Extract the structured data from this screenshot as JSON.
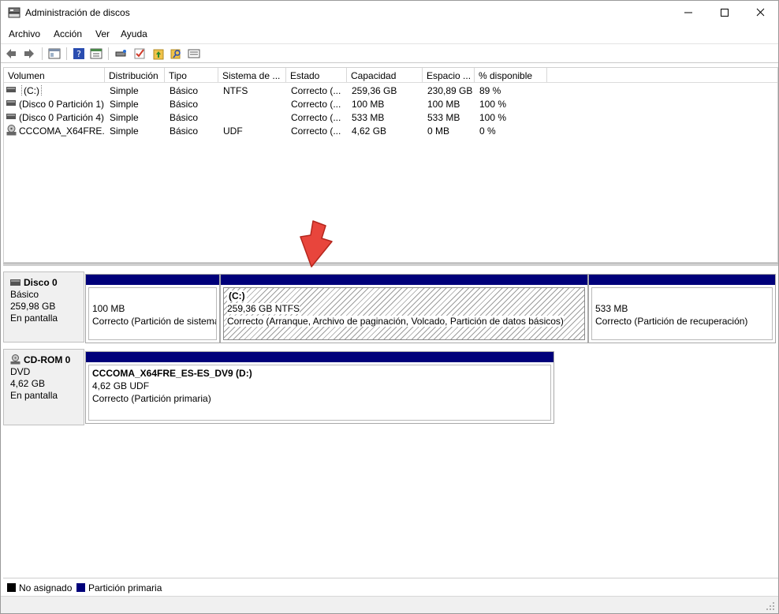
{
  "window": {
    "title": "Administración de discos",
    "controls": {
      "minimize": "—",
      "maximize": "☐",
      "close": "✕"
    }
  },
  "menu": [
    "Archivo",
    "Acción",
    "Ver",
    "Ayuda"
  ],
  "toolbar": {
    "icons": [
      "back-icon",
      "forward-icon",
      "console-tree-icon",
      "help-icon",
      "properties-icon",
      "connect-icon",
      "check-icon",
      "folder-up-icon",
      "search-folder-icon",
      "list-icon"
    ]
  },
  "volume_list": {
    "columns": [
      "Volumen",
      "Distribución",
      "Tipo",
      "Sistema de ...",
      "Estado",
      "Capacidad",
      "Espacio ...",
      "% disponible"
    ],
    "rows": [
      {
        "volume": "(C:)",
        "layout": "Simple",
        "type": "Básico",
        "fs": "NTFS",
        "status": "Correcto (...",
        "capacity": "259,36 GB",
        "free": "230,89 GB",
        "pct": "89 %"
      },
      {
        "volume": "(Disco 0 Partición 1)",
        "layout": "Simple",
        "type": "Básico",
        "fs": "",
        "status": "Correcto (...",
        "capacity": "100 MB",
        "free": "100 MB",
        "pct": "100 %"
      },
      {
        "volume": "(Disco 0 Partición 4)",
        "layout": "Simple",
        "type": "Básico",
        "fs": "",
        "status": "Correcto (...",
        "capacity": "533 MB",
        "free": "533 MB",
        "pct": "100 %"
      },
      {
        "volume": "CCCOMA_X64FRE...",
        "layout": "Simple",
        "type": "Básico",
        "fs": "UDF",
        "status": "Correcto (...",
        "capacity": "4,62 GB",
        "free": "0 MB",
        "pct": "0 %"
      }
    ]
  },
  "disks": [
    {
      "name": "Disco 0",
      "kind": "Básico",
      "size": "259,98 GB",
      "state": "En pantalla",
      "partitions": [
        {
          "title": "",
          "size": "100 MB",
          "status": "Correcto (Partición de sistema"
        },
        {
          "title": "(C:)",
          "size": "259,36 GB NTFS",
          "status": "Correcto (Arranque, Archivo de paginación, Volcado, Partición de datos básicos)"
        },
        {
          "title": "",
          "size": "533 MB",
          "status": "Correcto (Partición de recuperación)"
        }
      ]
    },
    {
      "name": "CD-ROM 0",
      "kind": "DVD",
      "size": "4,62 GB",
      "state": "En pantalla",
      "partitions": [
        {
          "title": "CCCOMA_X64FRE_ES-ES_DV9  (D:)",
          "size": "4,62 GB UDF",
          "status": "Correcto (Partición primaria)"
        }
      ]
    }
  ],
  "legend": [
    {
      "label": "No asignado",
      "color": "#000000"
    },
    {
      "label": "Partición primaria",
      "color": "#00007a"
    }
  ],
  "colors": {
    "primary_partition": "#00007a",
    "annotation_arrow": "#e8453c"
  }
}
